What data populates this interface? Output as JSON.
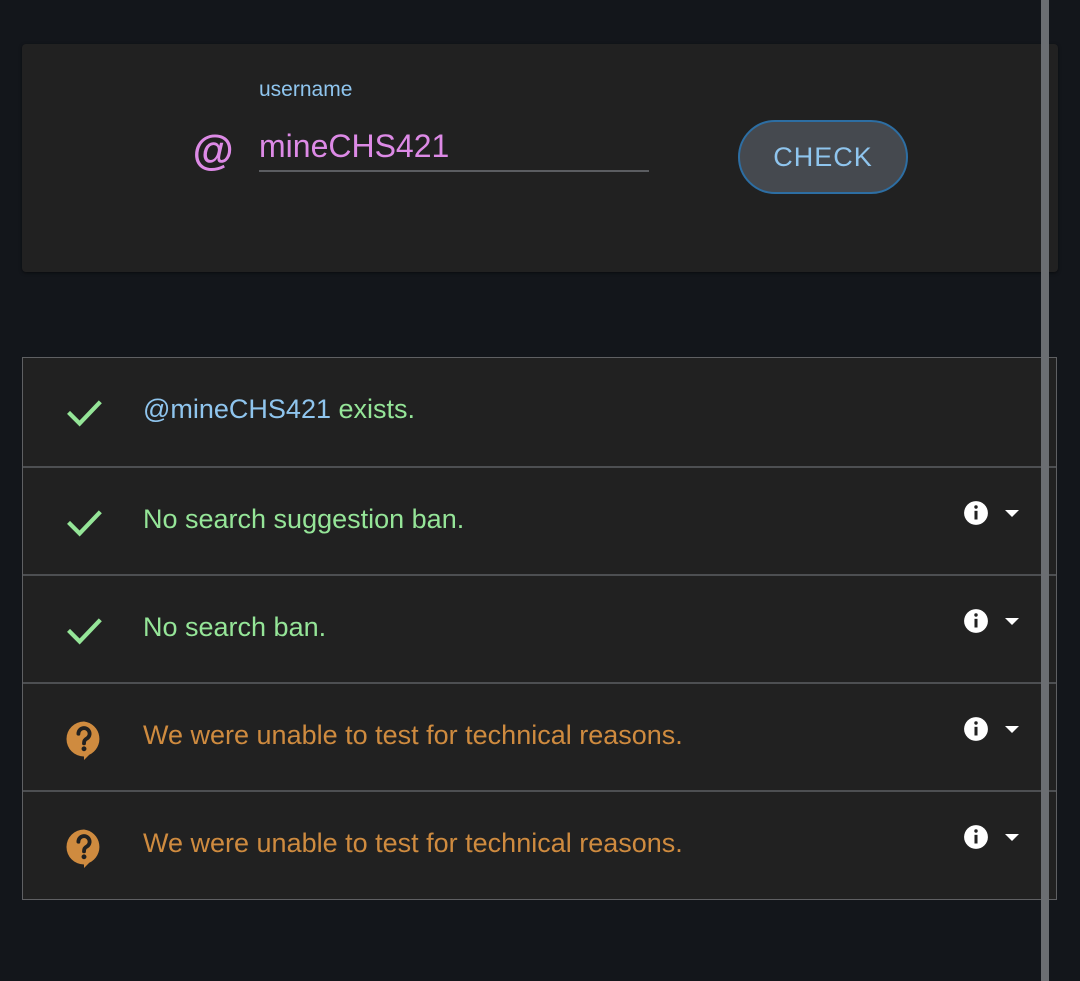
{
  "search": {
    "label": "username",
    "at_symbol": "@",
    "value": "mineCHS421",
    "button_label": "CHECK"
  },
  "results": [
    {
      "status": "ok",
      "icon": "check-icon",
      "handle": "@mineCHS421",
      "text": " exists.",
      "has_details": false
    },
    {
      "status": "ok",
      "icon": "check-icon",
      "text": "No search suggestion ban.",
      "has_details": true
    },
    {
      "status": "ok",
      "icon": "check-icon",
      "text": "No search ban.",
      "has_details": true
    },
    {
      "status": "unknown",
      "icon": "question-bubble-icon",
      "text": "We were unable to test for technical reasons.",
      "has_details": true
    },
    {
      "status": "unknown",
      "icon": "question-bubble-icon",
      "text": "We were unable to test for technical reasons.",
      "has_details": true
    }
  ],
  "colors": {
    "background": "#13161b",
    "card": "#212121",
    "ok": "#95e598",
    "unknown": "#cf8b3f",
    "accent_blue": "#8fc5ee",
    "accent_pink": "#dd8ae6"
  }
}
